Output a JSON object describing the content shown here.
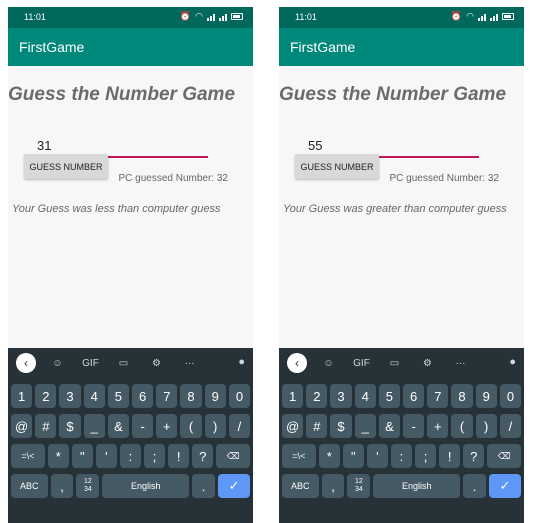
{
  "screens": [
    {
      "status_time": "11:01",
      "app_title": "FirstGame",
      "game_title": "Guess the Number Game",
      "input_value": "31",
      "button_label": "GUESS NUMBER",
      "pc_guess": "PC guessed Number: 32",
      "result": "Your Guess was less than computer guess"
    },
    {
      "status_time": "11:01",
      "app_title": "FirstGame",
      "game_title": "Guess the Number Game",
      "input_value": "55",
      "button_label": "GUESS NUMBER",
      "pc_guess": "PC guessed Number: 32",
      "result": "Your Guess was greater than computer guess"
    }
  ],
  "keyboard": {
    "toolbar": [
      "sticker-icon",
      "GIF",
      "clipboard-icon",
      "gear-icon",
      "···",
      "mic-icon"
    ],
    "row1": [
      "1",
      "2",
      "3",
      "4",
      "5",
      "6",
      "7",
      "8",
      "9",
      "0"
    ],
    "row2": [
      "@",
      "#",
      "$",
      "_",
      "&",
      "-",
      "+",
      "(",
      ")",
      "/"
    ],
    "row3": [
      "=\\<",
      "*",
      "\"",
      "'",
      ":",
      ";",
      "!",
      "?",
      "⌫"
    ],
    "row4": {
      "abc": "ABC",
      "comma": ",",
      "numpad": "12\n34",
      "space": "English",
      "period": ".",
      "enter": "✓"
    }
  },
  "colors": {
    "statusbar": "#00695c",
    "appbar": "#00897b",
    "accent": "#c2185b",
    "keyboard_bg": "#263238",
    "key_bg": "#455a64",
    "enter_key": "#5e97f6"
  }
}
